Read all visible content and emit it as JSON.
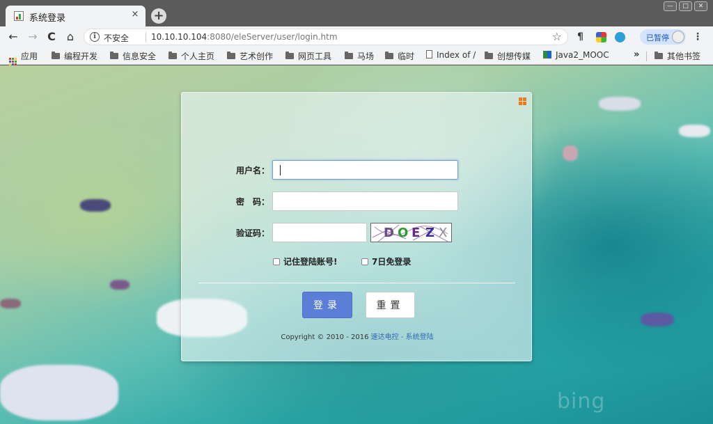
{
  "browser": {
    "tab_title": "系统登录",
    "tab_close": "×",
    "new_tab": "+",
    "window_buttons": [
      "—",
      "□",
      "✕"
    ],
    "back": "←",
    "forward": "→",
    "reload": "C",
    "home": "⌂",
    "security_label": "不安全",
    "url_host": "10.10.10.104",
    "url_rest": ":8080/eleServer/user/login.htm",
    "star": "☆",
    "ext_pilcrow": "¶",
    "paused_label": "已暂停",
    "menu": "⋮"
  },
  "bookmarks": {
    "apps_label": "应用",
    "items": [
      "编程开发",
      "信息安全",
      "个人主页",
      "艺术创作",
      "网页工具",
      "马场",
      "临时"
    ],
    "index_label": "Index of /",
    "item_after": "创想传媒",
    "java_label": "Java2_MOOC",
    "more": "»",
    "other": "其他书签"
  },
  "page": {
    "bing_logo": "bing"
  },
  "login": {
    "username_label": "用户名：",
    "username_value": "",
    "password_label": "密　码：",
    "password_value": "",
    "captcha_label": "验证码：",
    "captcha_value": "",
    "captcha_text": [
      "D",
      "O",
      "E",
      "Z",
      "X"
    ],
    "remember_label": "记住登陆账号!",
    "auto_login_label": "7日免登录",
    "login_button": "登录",
    "reset_button": "重置",
    "copyright_prefix": "Copyright © 2010 - 2016 ",
    "copyright_link": "速达电控 - 系统登陆",
    "accent_color": "#5b7fd6",
    "corner_icon_color": "#f07a18"
  }
}
